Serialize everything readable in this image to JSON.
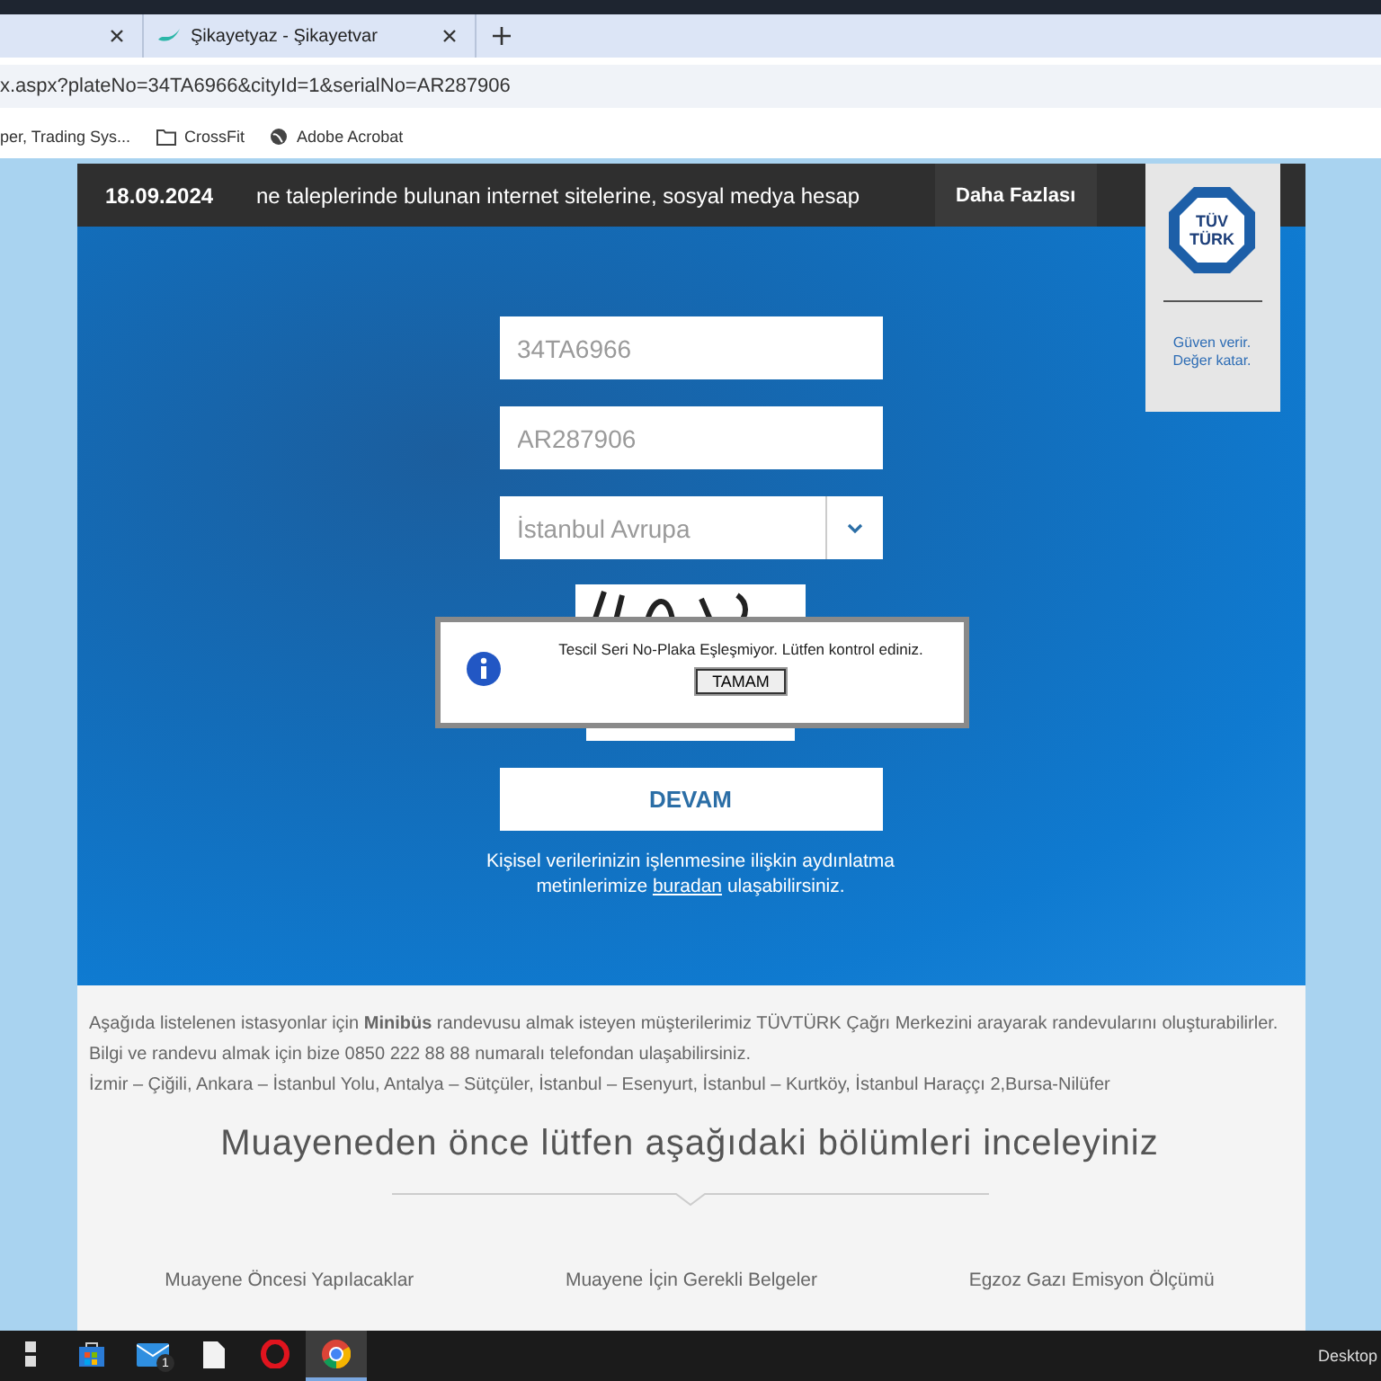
{
  "browser": {
    "tabs": [
      {
        "kind": "untitled"
      },
      {
        "kind": "titled",
        "title": "Şikayetyaz - Şikayetvar"
      }
    ],
    "address": "x.aspx?plateNo=34TA6966&cityId=1&serialNo=AR287906",
    "bookmarks": [
      {
        "kind": "page",
        "label": "per, Trading Sys..."
      },
      {
        "kind": "folder",
        "label": "CrossFit"
      },
      {
        "kind": "globe",
        "label": "Adobe Acrobat"
      }
    ]
  },
  "header": {
    "date": "18.09.2024",
    "ticker": "ne taleplerinde bulunan internet sitelerine, sosyal medya hesap",
    "more": "Daha Fazlası",
    "logo_top": "TÜV",
    "logo_bottom": "TÜRK",
    "slogan": "Güven verir. Değer katar."
  },
  "form": {
    "plate": {
      "value": "34TA6966"
    },
    "serial": {
      "value": "AR287906"
    },
    "city": {
      "value": "İstanbul Avrupa"
    },
    "submit": "DEVAM",
    "privacy_before": "Kişisel verilerinizin işlenmesine ilişkin aydınlatma metinlerimize",
    "privacy_link": "buradan",
    "privacy_after": "ulaşabilirsiniz."
  },
  "dialog": {
    "message": "Tescil Seri No-Plaka Eşleşmiyor. Lütfen kontrol ediniz.",
    "button": "TAMAM"
  },
  "info": {
    "lines": [
      "Aşağıda listelenen istasyonlar için **Minibüs** randevusu almak isteyen müşterilerimiz TÜVTÜRK Çağrı Merkezini arayarak randevularını oluşturabilirler.",
      "Bilgi ve randevu almak için bize 0850 222 88 88 numaralı telefondan ulaşabilirsiniz.",
      "İzmir – Çiğili, Ankara – İstanbul Yolu, Antalya – Sütçüler, İstanbul – Esenyurt, İstanbul – Kurtköy, İstanbul Haraççı 2,Bursa-Nilüfer"
    ]
  },
  "section": {
    "title": "Muayeneden önce lütfen aşağıdaki bölümleri inceleyiniz",
    "links": [
      "Muayene Öncesi Yapılacaklar",
      "Muayene İçin Gerekli Belgeler",
      "Egzoz Gazı Emisyon Ölçümü"
    ]
  },
  "taskbar": {
    "apps": [
      {
        "kind": "windows",
        "active": false
      },
      {
        "kind": "store",
        "active": false
      },
      {
        "kind": "mail",
        "active": false,
        "badge": "1"
      },
      {
        "kind": "file",
        "active": false
      },
      {
        "kind": "opera",
        "active": false
      },
      {
        "kind": "chrome",
        "active": true
      }
    ],
    "desktop": "Desktop"
  }
}
